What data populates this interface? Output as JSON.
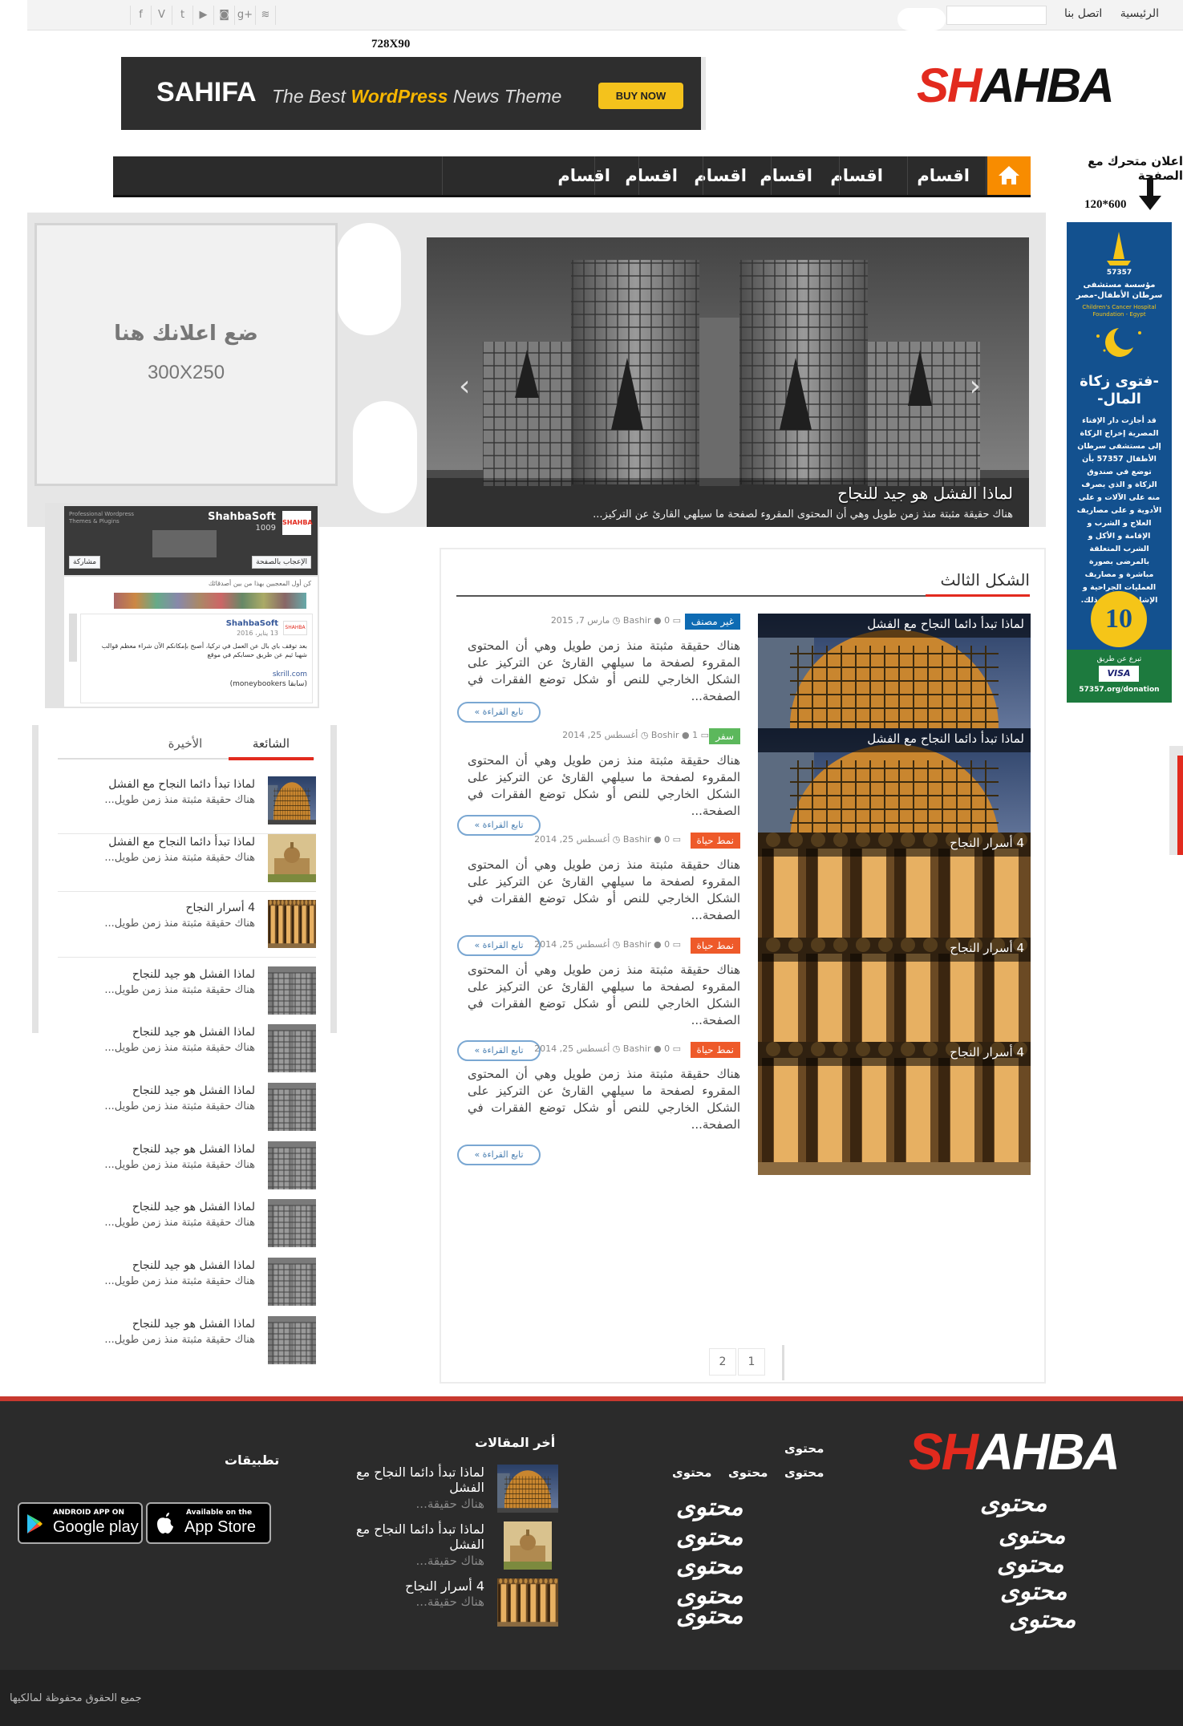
{
  "topbar": {
    "nav": [
      "الرئيسية",
      "اتصل بنا"
    ],
    "social_icons": [
      "rss-icon",
      "google-plus-icon",
      "instagram-icon",
      "youtube-icon",
      "twitter-icon",
      "vine-icon",
      "facebook-icon"
    ]
  },
  "logo": {
    "part1": "SH",
    "part2": "AHBA"
  },
  "banner": {
    "size_label": "728X90",
    "title": "SAHIFA",
    "sub_pre": "The Best ",
    "sub_accent": "WordPress",
    "sub_post": " News Theme",
    "button": "BUY NOW"
  },
  "mainnav": {
    "items": [
      "اقسام",
      "اقسام",
      "اقسام",
      "اقسام",
      "اقسام",
      "اقسام"
    ]
  },
  "side": {
    "sticky_note": "اعلان متحرك مع الصفحة",
    "sky_size": "120*600"
  },
  "skyscraper": {
    "code": "57357",
    "org": "مؤسسة مستشفى سرطان الأطفال-مصر",
    "org_en": "Children's Cancer Hospital Foundation - Egypt",
    "title": "-فتوى زكاة المال-",
    "body": "قد أجازت دار الإفتاء المصرية إخراج الزكاة إلى مستشفى سرطان الأطفال 57357 بأن توضع في صندوق الزكاة و الذي يصرف منه على الآلات و على الأدوية و على مصاريف العلاج و الشرب و الإقامة و الأكل و الشرب المتعلقة بالمرضى بصورة مباشرة و مصاريف العمليات الجراحية و الإشاعات و غير ذلك.",
    "badge": "10",
    "donate": "تبرع عن طريق",
    "url": "57357.org/donation"
  },
  "slider": {
    "title": "لماذا الفشل هو جيد للنجاح",
    "excerpt": "هناك حقيقة مثبتة منذ زمن طويل وهي أن المحتوى المقروء لصفحة ما سيلهي القارئ عن التركيز..."
  },
  "ad300": {
    "text": "ضع اعلانك هنا",
    "size": "300X250"
  },
  "fb": {
    "name": "ShahbaSoft",
    "tagline": "Professional Wordpress Themes & Plugins",
    "likes": "1009",
    "like_btn": "الإعجاب بالصفحة",
    "share_btn": "مشاركة",
    "friends": "كن أول المعجبين بهذا من بين أصدقائك",
    "post_name": "ShahbaSoft",
    "post_date": "13 يناير، 2016",
    "post_text": "بعد توقف باي بال عن العمل في تركيا، أصبح بإمكانكم الآن شراء معظم قوالب شهبا ثيم عن طريق حسابكم في موقع",
    "post_link": "skrill.com",
    "post_extra": "(سابقا moneybookers)"
  },
  "section": {
    "title": "الشكل الثالث"
  },
  "posts": [
    {
      "img_title": "لماذا تبدأ دائما النجاح مع الفشل",
      "cat": "غير مصنف",
      "cat_color": "#0e6bb3",
      "comments": "0",
      "author": "Bashir",
      "date": "مارس 7, 2015",
      "excerpt": "هناك حقيقة مثبتة منذ زمن طويل وهي أن المحتوى المقروء لصفحة ما سيلهي القارئ عن التركيز على الشكل الخارجي للنص أو شكل توضع الفقرات في الصفحة...",
      "more": "تابع القراءة »"
    },
    {
      "img_title": "لماذا تبدأ دائما النجاح مع الفشل",
      "cat": "سفر",
      "cat_color": "#5cb85c",
      "comments": "1",
      "author": "Boshir",
      "date": "أغسطس 25, 2014",
      "excerpt": "هناك حقيقة مثبتة منذ زمن طويل وهي أن المحتوى المقروء لصفحة ما سيلهي القارئ عن التركيز على الشكل الخارجي للنص أو شكل توضع الفقرات في الصفحة...",
      "more": "تابع القراءة »"
    },
    {
      "img_title": "4 أسرار النجاح",
      "cat": "نمط حياة",
      "cat_color": "#ee5a2a",
      "comments": "0",
      "author": "Bashir",
      "date": "أغسطس 25, 2014",
      "excerpt": "هناك حقيقة مثبتة منذ زمن طويل وهي أن المحتوى المقروء لصفحة ما سيلهي القارئ عن التركيز على الشكل الخارجي للنص أو شكل توضع الفقرات في الصفحة...",
      "more": "تابع القراءة »"
    },
    {
      "img_title": "4 أسرار النجاح",
      "cat": "نمط حياة",
      "cat_color": "#ee5a2a",
      "comments": "0",
      "author": "Bashir",
      "date": "أغسطس 25, 2014",
      "excerpt": "هناك حقيقة مثبتة منذ زمن طويل وهي أن المحتوى المقروء لصفحة ما سيلهي القارئ عن التركيز على الشكل الخارجي للنص أو شكل توضع الفقرات في الصفحة...",
      "more": "تابع القراءة »"
    },
    {
      "img_title": "4 أسرار النجاح",
      "cat": "نمط حياة",
      "cat_color": "#ee5a2a",
      "comments": "0",
      "author": "Bashir",
      "date": "أغسطس 25, 2014",
      "excerpt": "هناك حقيقة مثبتة منذ زمن طويل وهي أن المحتوى المقروء لصفحة ما سيلهي القارئ عن التركيز على الشكل الخارجي للنص أو شكل توضع الفقرات في الصفحة...",
      "more": "تابع القراءة »"
    }
  ],
  "pagination": [
    "1",
    "2"
  ],
  "tabs": {
    "popular": "الشائعة",
    "recent": "الأخيرة",
    "items": [
      {
        "title": "لماذا تبدأ دائما النجاح مع الفشل",
        "excerpt": "هناك حقيقة مثبتة منذ زمن طويل...",
        "thumb": "mall"
      },
      {
        "title": "لماذا تبدأ دائما النجاح مع الفشل",
        "excerpt": "هناك حقيقة مثبتة منذ زمن طويل...",
        "thumb": "capitol"
      },
      {
        "title": "4 أسرار النجاح",
        "excerpt": "هناك حقيقة مثبتة منذ زمن طويل...",
        "thumb": "hall"
      },
      {
        "title": "لماذا الفشل هو جيد للنجاح",
        "excerpt": "هناك حقيقة مثبتة منذ زمن طويل...",
        "thumb": "concrete"
      },
      {
        "title": "لماذا الفشل هو جيد للنجاح",
        "excerpt": "هناك حقيقة مثبتة منذ زمن طويل...",
        "thumb": "concrete"
      },
      {
        "title": "لماذا الفشل هو جيد للنجاح",
        "excerpt": "هناك حقيقة مثبتة منذ زمن طويل...",
        "thumb": "concrete"
      },
      {
        "title": "لماذا الفشل هو جيد للنجاح",
        "excerpt": "هناك حقيقة مثبتة منذ زمن طويل...",
        "thumb": "concrete"
      },
      {
        "title": "لماذا الفشل هو جيد للنجاح",
        "excerpt": "هناك حقيقة مثبتة منذ زمن طويل...",
        "thumb": "concrete"
      },
      {
        "title": "لماذا الفشل هو جيد للنجاح",
        "excerpt": "هناك حقيقة مثبتة منذ زمن طويل...",
        "thumb": "concrete"
      },
      {
        "title": "لماذا الفشل هو جيد للنجاح",
        "excerpt": "هناك حقيقة مثبتة منذ زمن طويل...",
        "thumb": "concrete"
      }
    ]
  },
  "footer": {
    "col_logo_items": [
      "محتوى",
      "محتوى",
      "محتوى",
      "محتوى",
      "محتوى"
    ],
    "col_content_head": "محتوى",
    "col_content_sub": [
      "محتوى",
      "محتوى",
      "محتوى"
    ],
    "col_content_items": [
      "محتوى",
      "محتوى",
      "محتوى",
      "محتوى",
      "محتوى"
    ],
    "articles_head": "أخر المقالات",
    "articles": [
      {
        "title": "لماذا تبدأ دائما النجاح مع الفشل",
        "excerpt": "هناك حقيقة...",
        "thumb": "mall"
      },
      {
        "title": "لماذا تبدأ دائما النجاح مع الفشل",
        "excerpt": "هناك حقيقة...",
        "thumb": "capitol"
      },
      {
        "title": "4 أسرار النجاح",
        "excerpt": "هناك حقيقة...",
        "thumb": "hall"
      }
    ],
    "apps_head": "تطبيقات",
    "appstore_small": "Available on the",
    "appstore_big": "App Store",
    "google_small": "ANDROID APP ON",
    "google_big": "Google play",
    "copyright": "جميع الحقوق محفوظة لمالكيها"
  },
  "colors": {
    "accent": "#e22a1e",
    "nav_home": "#f88c00",
    "nav_bg": "#2b2b2b",
    "footer_bg": "#2b2b2b"
  }
}
